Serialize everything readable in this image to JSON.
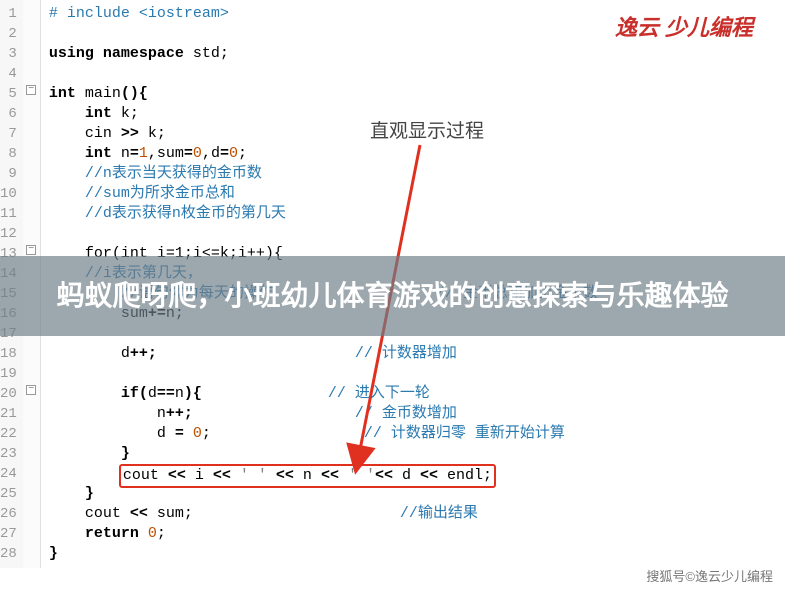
{
  "logo": "逸云 少儿编程",
  "annotation": "直观显示过程",
  "overlay": "蚂蚁爬呀爬，小班幼儿体育游戏的创意探索与乐趣体验",
  "source": "搜狐号©逸云少儿编程",
  "line_numbers": [
    "1",
    "2",
    "3",
    "4",
    "5",
    "6",
    "7",
    "8",
    "9",
    "10",
    "11",
    "12",
    "13",
    "14",
    "15",
    "16",
    "17",
    "18",
    "19",
    "20",
    "21",
    "22",
    "23",
    "24",
    "25",
    "26",
    "27",
    "28"
  ],
  "code": {
    "l1": "# include <iostream>",
    "l3a": "using",
    "l3b": " namespace",
    "l3c": " std",
    "l3d": ";",
    "l5a": "int",
    "l5b": " main",
    "l5c": "(){",
    "l6a": "    int",
    "l6b": " k",
    "l6c": ";",
    "l7a": "    cin ",
    "l7b": ">>",
    "l7c": " k",
    "l7d": ";",
    "l8a": "    int",
    "l8b": " n",
    "l8c": "=",
    "l8d": "1",
    "l8e": ",",
    "l8f": "sum",
    "l8g": "=",
    "l8h": "0",
    "l8i": ",",
    "l8j": "d",
    "l8k": "=",
    "l8l": "0",
    "l8m": ";",
    "l9": "    //n表示当天获得的金币数",
    "l10": "    //sum为所求金币总和",
    "l11": "    //d表示获得n枚金币的第几天",
    "l13": "    for(int i=1;i<=k;i++){",
    "l14": "    //i表示第几天，",
    "l15a": "        //语句体为每天的操作",
    "l15b": "                  // 金币总和加上金币数",
    "l16a": "        sum",
    "l16b": "+=",
    "l16c": "n",
    "l16d": ";",
    "l18a": "        d",
    "l18b": "++;",
    "l18c": "                      // 计数器增加",
    "l20a": "        if",
    "l20b": "(",
    "l20c": "d",
    "l20d": "==",
    "l20e": "n",
    "l20f": "){",
    "l20g": "              // 进入下一轮",
    "l21a": "            n",
    "l21b": "++;",
    "l21c": "                  // 金币数增加",
    "l22a": "            d ",
    "l22b": "=",
    "l22c": " 0",
    "l22d": ";",
    "l22e": "                 // 计数器归零 重新开始计算",
    "l23": "        }",
    "l24a": "        ",
    "l24b": "cout ",
    "l24c": "<<",
    "l24d": " i ",
    "l24e": "<<",
    "l24f": " ' '",
    "l24g": " << ",
    "l24h": "n ",
    "l24i": "<<",
    "l24j": " ' '",
    "l24k": "<<",
    "l24l": " d ",
    "l24m": "<<",
    "l24n": " endl",
    "l24o": ";",
    "l25": "    }",
    "l26a": "    cout ",
    "l26b": "<<",
    "l26c": " sum",
    "l26d": ";",
    "l26e": "                       //输出结果",
    "l27a": "    return",
    "l27b": " 0",
    "l27c": ";",
    "l28": "}"
  }
}
